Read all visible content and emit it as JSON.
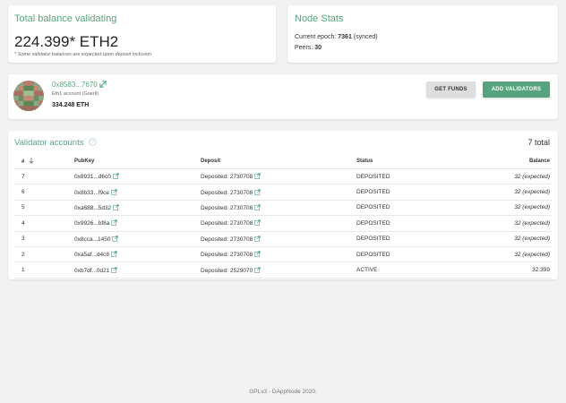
{
  "balance": {
    "title": "Total balance validating",
    "amount": "224.399* ETH2",
    "note": "* Some validator balances are expected upon deposit inclusion"
  },
  "node_stats": {
    "title": "Node Stats",
    "epoch_label": "Current epoch:",
    "epoch_value": "7361",
    "epoch_suffix": "(synced)",
    "peers_label": "Peers:",
    "peers_value": "30"
  },
  "account": {
    "address": "0x8583...7670",
    "subtitle": "Eth1 account (Goerli)",
    "balance": "334.248 ETH",
    "get_funds_label": "GET FUNDS",
    "add_validators_label": "ADD VALIDATORS"
  },
  "validators": {
    "title": "Validator accounts",
    "total": "7 total",
    "columns": {
      "index": "#",
      "pubkey": "PubKey",
      "deposit": "Deposit",
      "status": "Status",
      "balance": "Balance"
    },
    "rows": [
      {
        "index": "7",
        "pubkey": "0x8931...d6c0",
        "deposit": "Deposited: 2730708",
        "status": "DEPOSITED",
        "balance": "32 (expected)"
      },
      {
        "index": "6",
        "pubkey": "0x8b33...f9ce",
        "deposit": "Deposited: 2730708",
        "status": "DEPOSITED",
        "balance": "32 (expected)"
      },
      {
        "index": "5",
        "pubkey": "0xa688...5d32",
        "deposit": "Deposited: 2730708",
        "status": "DEPOSITED",
        "balance": "32 (expected)"
      },
      {
        "index": "4",
        "pubkey": "0x9926...bf8a",
        "deposit": "Deposited: 2730708",
        "status": "DEPOSITED",
        "balance": "32 (expected)"
      },
      {
        "index": "3",
        "pubkey": "0x8cca...1450",
        "deposit": "Deposited: 2730708",
        "status": "DEPOSITED",
        "balance": "32 (expected)"
      },
      {
        "index": "2",
        "pubkey": "0xa5af...d4c8",
        "deposit": "Deposited: 2730708",
        "status": "DEPOSITED",
        "balance": "32 (expected)"
      },
      {
        "index": "1",
        "pubkey": "0xb7df...0d21",
        "deposit": "Deposited: 2529070",
        "status": "ACTIVE",
        "balance": "32.399"
      }
    ]
  },
  "footer": "GPLv3 - DAppNode 2020.",
  "colors": {
    "accent": "#57a37d",
    "background": "#f2f2f2"
  },
  "icons": [
    "external-link-icon",
    "help-circle-icon",
    "sort-arrow-down-icon",
    "avatar-identicon"
  ]
}
